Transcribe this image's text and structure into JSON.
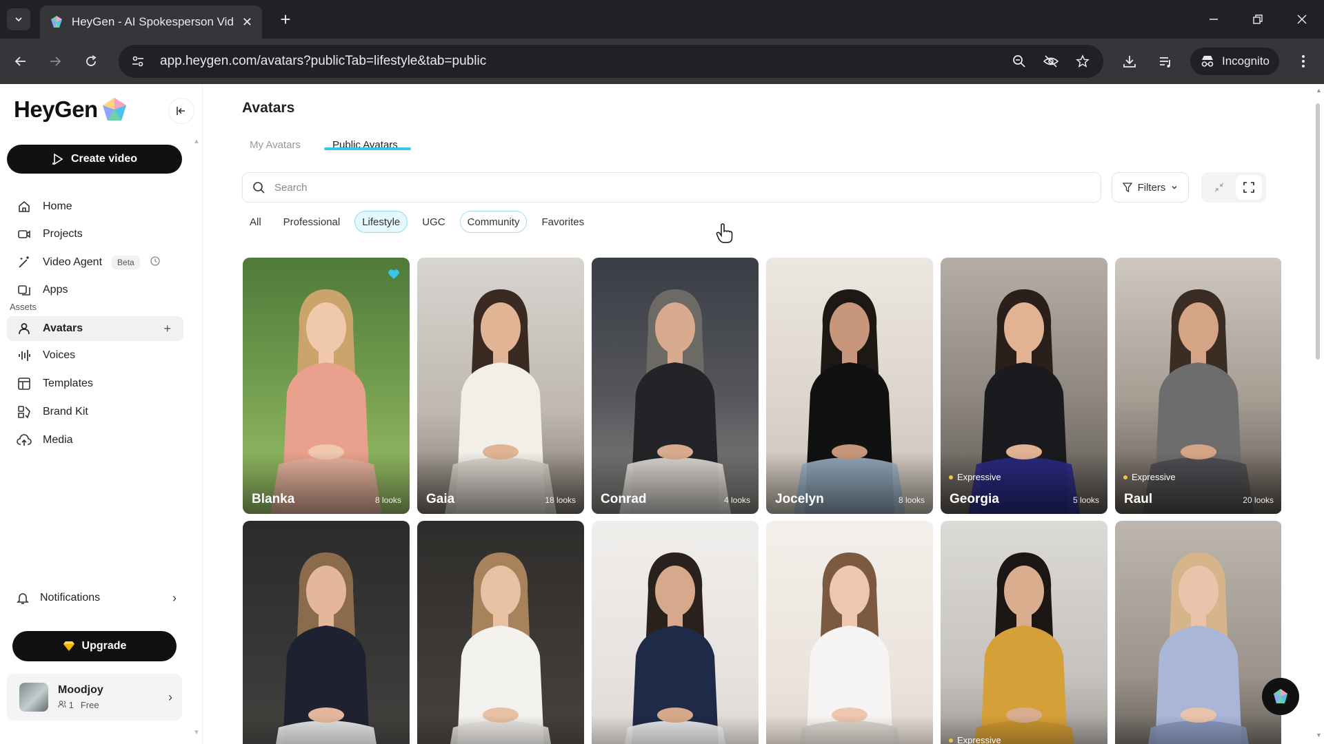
{
  "browser": {
    "tab_title": "HeyGen - AI Spokesperson Vid",
    "url": "app.heygen.com/avatars?publicTab=lifestyle&tab=public",
    "incognito_label": "Incognito"
  },
  "sidebar": {
    "logo_text": "HeyGen",
    "create_video_label": "Create video",
    "nav": [
      {
        "label": "Home",
        "icon": "home-icon"
      },
      {
        "label": "Projects",
        "icon": "video-icon"
      },
      {
        "label": "Video Agent",
        "icon": "wand-icon",
        "badge": "Beta"
      },
      {
        "label": "Apps",
        "icon": "apps-icon"
      }
    ],
    "assets_label": "Assets",
    "assets": [
      {
        "label": "Avatars",
        "icon": "user-icon",
        "active": true
      },
      {
        "label": "Voices",
        "icon": "waveform-icon"
      },
      {
        "label": "Templates",
        "icon": "layout-icon"
      },
      {
        "label": "Brand Kit",
        "icon": "brand-icon"
      },
      {
        "label": "Media",
        "icon": "upload-cloud-icon"
      }
    ],
    "notifications_label": "Notifications",
    "upgrade_label": "Upgrade",
    "user": {
      "name": "Moodjoy",
      "members": "1",
      "plan": "Free"
    }
  },
  "main": {
    "title": "Avatars",
    "tabs": [
      {
        "label": "My Avatars",
        "active": false
      },
      {
        "label": "Public Avatars",
        "active": true
      }
    ],
    "search_placeholder": "Search",
    "filters_label": "Filters",
    "chips": [
      {
        "label": "All",
        "selected": false
      },
      {
        "label": "Professional",
        "selected": false
      },
      {
        "label": "Lifestyle",
        "selected": true
      },
      {
        "label": "UGC",
        "selected": false
      },
      {
        "label": "Community",
        "selected": false,
        "hover": true
      },
      {
        "label": "Favorites",
        "selected": false
      }
    ],
    "avatars": [
      {
        "name": "Blanka",
        "looks": "8 looks",
        "expressive": "",
        "favorite": true
      },
      {
        "name": "Gaia",
        "looks": "18 looks",
        "expressive": ""
      },
      {
        "name": "Conrad",
        "looks": "4 looks",
        "expressive": ""
      },
      {
        "name": "Jocelyn",
        "looks": "8 looks",
        "expressive": ""
      },
      {
        "name": "Georgia",
        "looks": "5 looks",
        "expressive": "Expressive"
      },
      {
        "name": "Raul",
        "looks": "20 looks",
        "expressive": "Expressive"
      },
      {
        "name": "",
        "looks": "",
        "expressive": ""
      },
      {
        "name": "",
        "looks": "",
        "expressive": ""
      },
      {
        "name": "",
        "looks": "",
        "expressive": ""
      },
      {
        "name": "",
        "looks": "",
        "expressive": ""
      },
      {
        "name": "",
        "looks": "",
        "expressive": "Expressive"
      },
      {
        "name": "",
        "looks": "",
        "expressive": ""
      }
    ]
  }
}
